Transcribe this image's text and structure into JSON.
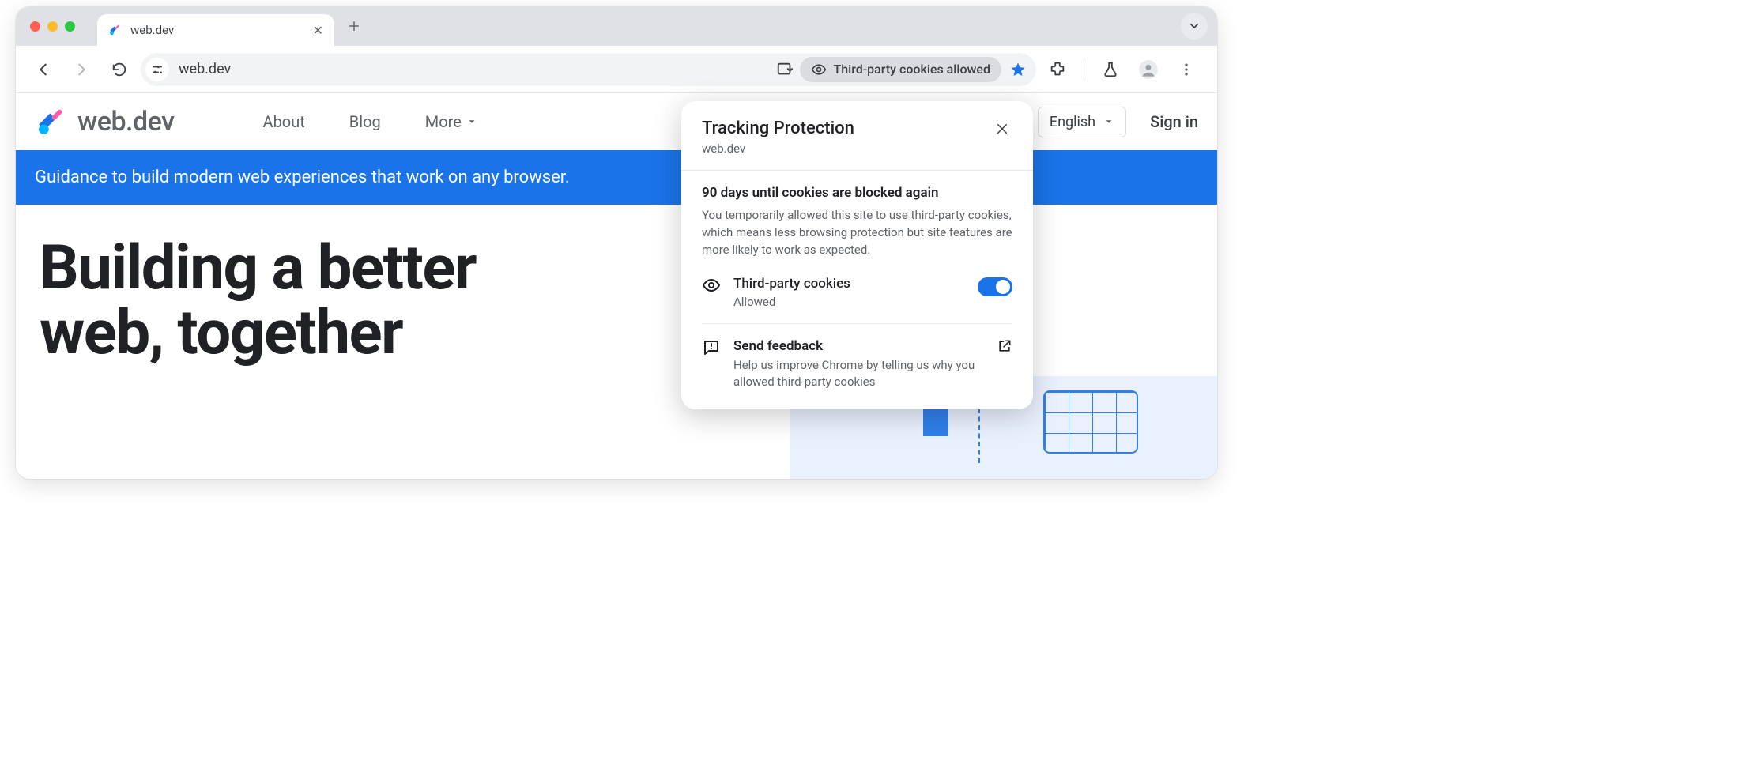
{
  "browser": {
    "tab_title": "web.dev",
    "address": "web.dev",
    "cookie_chip": "Third-party cookies allowed"
  },
  "site": {
    "brand": "web.dev",
    "nav": {
      "about": "About",
      "blog": "Blog",
      "more": "More"
    },
    "language": "English",
    "signin": "Sign in",
    "banner": "Guidance to build modern web experiences that work on any browser.",
    "hero_line1": "Building a better",
    "hero_line2": "web, together"
  },
  "popover": {
    "title": "Tracking Protection",
    "host": "web.dev",
    "heading": "90 days until cookies are blocked again",
    "body": "You temporarily allowed this site to use third-party cookies, which means less browsing protection but site features are more likely to work as expected.",
    "cookie_label": "Third-party cookies",
    "cookie_state": "Allowed",
    "feedback_title": "Send feedback",
    "feedback_body": "Help us improve Chrome by telling us why you allowed third-party cookies"
  }
}
